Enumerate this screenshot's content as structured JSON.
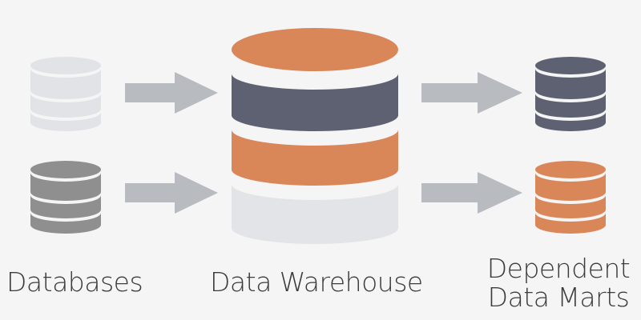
{
  "labels": {
    "databases": "Databases",
    "warehouse": "Data Warehouse",
    "marts_line1": "Dependent",
    "marts_line2": "Data Marts"
  },
  "colors": {
    "background": "#f5f5f5",
    "source_db_light": "#e2e3e7",
    "source_db_dark": "#8f8f8f",
    "warehouse_orange": "#d98659",
    "warehouse_slate": "#5d6171",
    "warehouse_light": "#e3e4e8",
    "arrow": "#b8bbc0",
    "mart_slate": "#5d6171",
    "mart_orange": "#d98659",
    "text": "#3c3c3c"
  },
  "icons": {
    "source_db_top": "database-icon",
    "source_db_bottom": "database-icon",
    "warehouse": "data-warehouse-cylinder",
    "mart_top": "database-icon",
    "mart_bottom": "database-icon",
    "arrows": "arrow-right-icon"
  }
}
